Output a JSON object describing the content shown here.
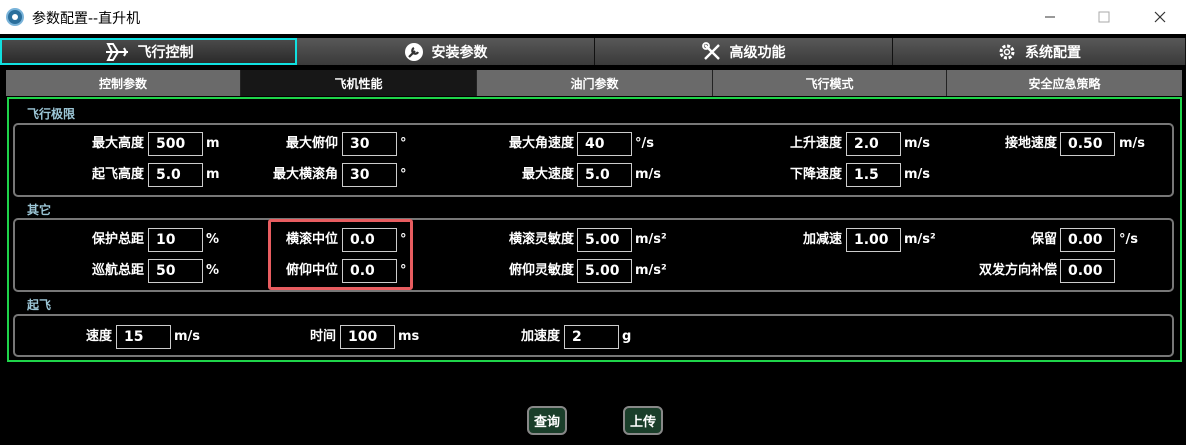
{
  "window": {
    "title": "参数配置--直升机"
  },
  "main_tabs": [
    {
      "label": "飞行控制",
      "icon": "airplane-icon"
    },
    {
      "label": "安装参数",
      "icon": "wrench-circle-icon"
    },
    {
      "label": "高级功能",
      "icon": "tools-icon"
    },
    {
      "label": "系统配置",
      "icon": "gear-icon"
    }
  ],
  "sub_tabs": [
    "控制参数",
    "飞机性能",
    "油门参数",
    "飞行模式",
    "安全应急策略"
  ],
  "sections": {
    "limits": {
      "title": "飞行极限",
      "fields": [
        {
          "label": "最大高度",
          "value": "500",
          "unit": "m"
        },
        {
          "label": "最大俯仰",
          "value": "30",
          "unit": "°"
        },
        {
          "label": "最大角速度",
          "value": "40",
          "unit": "°/s"
        },
        {
          "label": "上升速度",
          "value": "2.0",
          "unit": "m/s"
        },
        {
          "label": "接地速度",
          "value": "0.50",
          "unit": "m/s"
        },
        {
          "label": "起飞高度",
          "value": "5.0",
          "unit": "m"
        },
        {
          "label": "最大横滚角",
          "value": "30",
          "unit": "°"
        },
        {
          "label": "最大速度",
          "value": "5.0",
          "unit": "m/s"
        },
        {
          "label": "下降速度",
          "value": "1.5",
          "unit": "m/s"
        }
      ]
    },
    "other": {
      "title": "其它",
      "fields": [
        {
          "label": "保护总距",
          "value": "10",
          "unit": "%"
        },
        {
          "label": "横滚中位",
          "value": "0.0",
          "unit": "°"
        },
        {
          "label": "横滚灵敏度",
          "value": "5.00",
          "unit": "m/s²"
        },
        {
          "label": "加减速",
          "value": "1.00",
          "unit": "m/s²"
        },
        {
          "label": "保留",
          "value": "0.00",
          "unit": "°/s"
        },
        {
          "label": "巡航总距",
          "value": "50",
          "unit": "%"
        },
        {
          "label": "俯仰中位",
          "value": "0.0",
          "unit": "°"
        },
        {
          "label": "俯仰灵敏度",
          "value": "5.00",
          "unit": "m/s²"
        },
        {
          "label": "双发方向补偿",
          "value": "0.00",
          "unit": ""
        }
      ]
    },
    "takeoff": {
      "title": "起飞",
      "fields": [
        {
          "label": "速度",
          "value": "15",
          "unit": "m/s"
        },
        {
          "label": "时间",
          "value": "100",
          "unit": "ms"
        },
        {
          "label": "加速度",
          "value": "2",
          "unit": "g"
        }
      ]
    }
  },
  "buttons": {
    "query": "查询",
    "upload": "上传"
  },
  "colors": {
    "active_main_tab_border": "#10e0e0",
    "panel_border": "#1fd44a",
    "highlight_box": "#e85d60",
    "section_title": "#9cc6d6"
  }
}
